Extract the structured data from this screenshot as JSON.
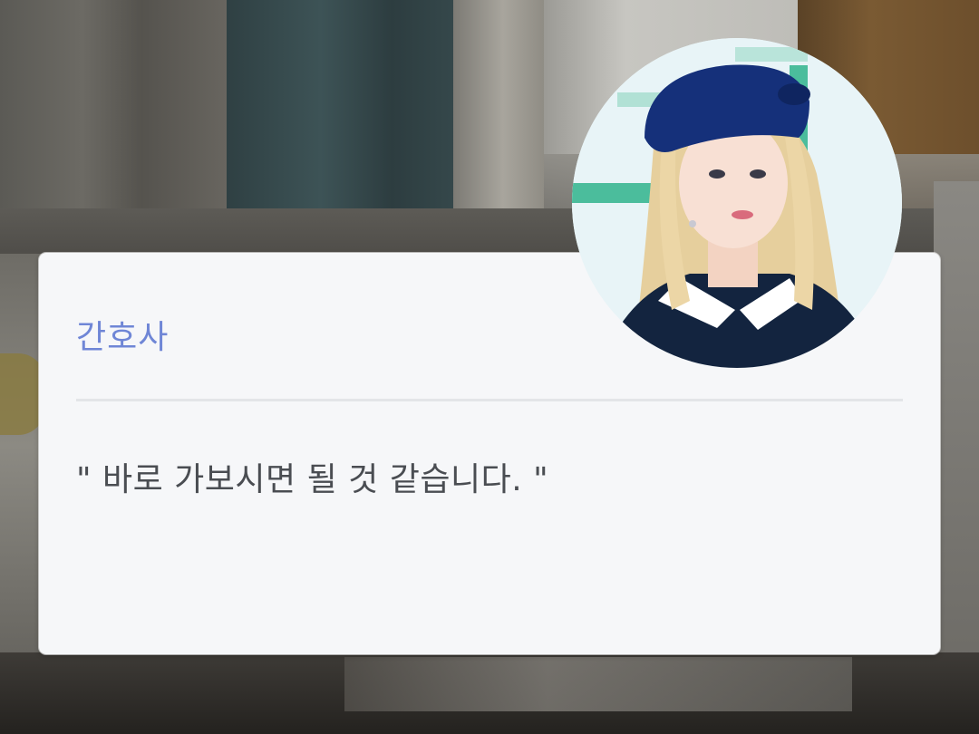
{
  "scene": {
    "background": "hospital-room",
    "colors": {
      "card": "#f6f7f9",
      "speaker": "#6f86d6",
      "text": "#4a4d52",
      "divider": "#e3e5e8"
    }
  },
  "dialog": {
    "speaker": "간호사",
    "line": "\" 바로 가보시면 될 것 같습니다. \""
  },
  "avatar": {
    "icon": "character-portrait"
  }
}
